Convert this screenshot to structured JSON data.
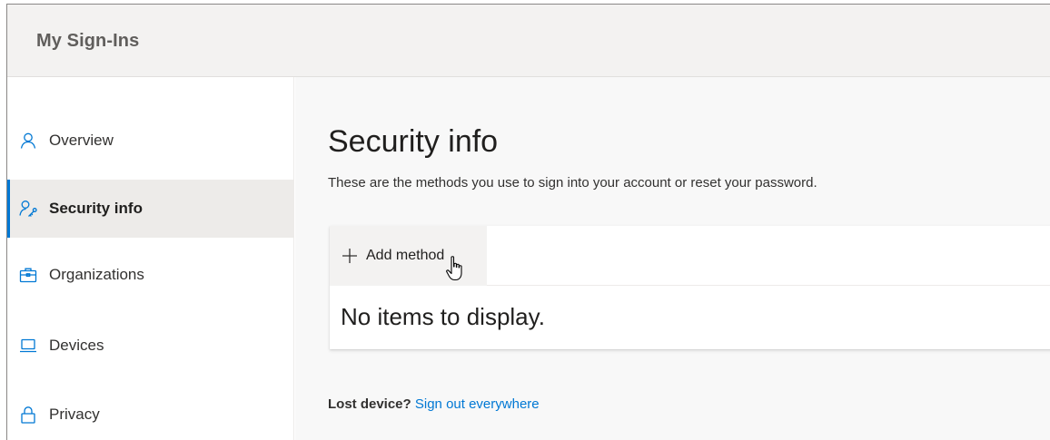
{
  "header": {
    "app_title": "My Sign-Ins"
  },
  "sidebar": {
    "items": [
      {
        "label": "Overview",
        "icon": "person-icon",
        "active": false
      },
      {
        "label": "Security info",
        "icon": "security-person-key-icon",
        "active": true
      },
      {
        "label": "Organizations",
        "icon": "briefcase-icon",
        "active": false
      },
      {
        "label": "Devices",
        "icon": "laptop-icon",
        "active": false
      },
      {
        "label": "Privacy",
        "icon": "lock-icon",
        "active": false
      }
    ]
  },
  "main": {
    "title": "Security info",
    "subtitle": "These are the methods you use to sign into your account or reset your password.",
    "add_method_label": "Add method",
    "empty_text": "No items to display.",
    "lost_device_question": "Lost device?",
    "sign_out_link": "Sign out everywhere"
  },
  "colors": {
    "accent": "#0078d4",
    "header_bg": "#f3f2f1",
    "active_nav_bg": "#edebe9"
  }
}
